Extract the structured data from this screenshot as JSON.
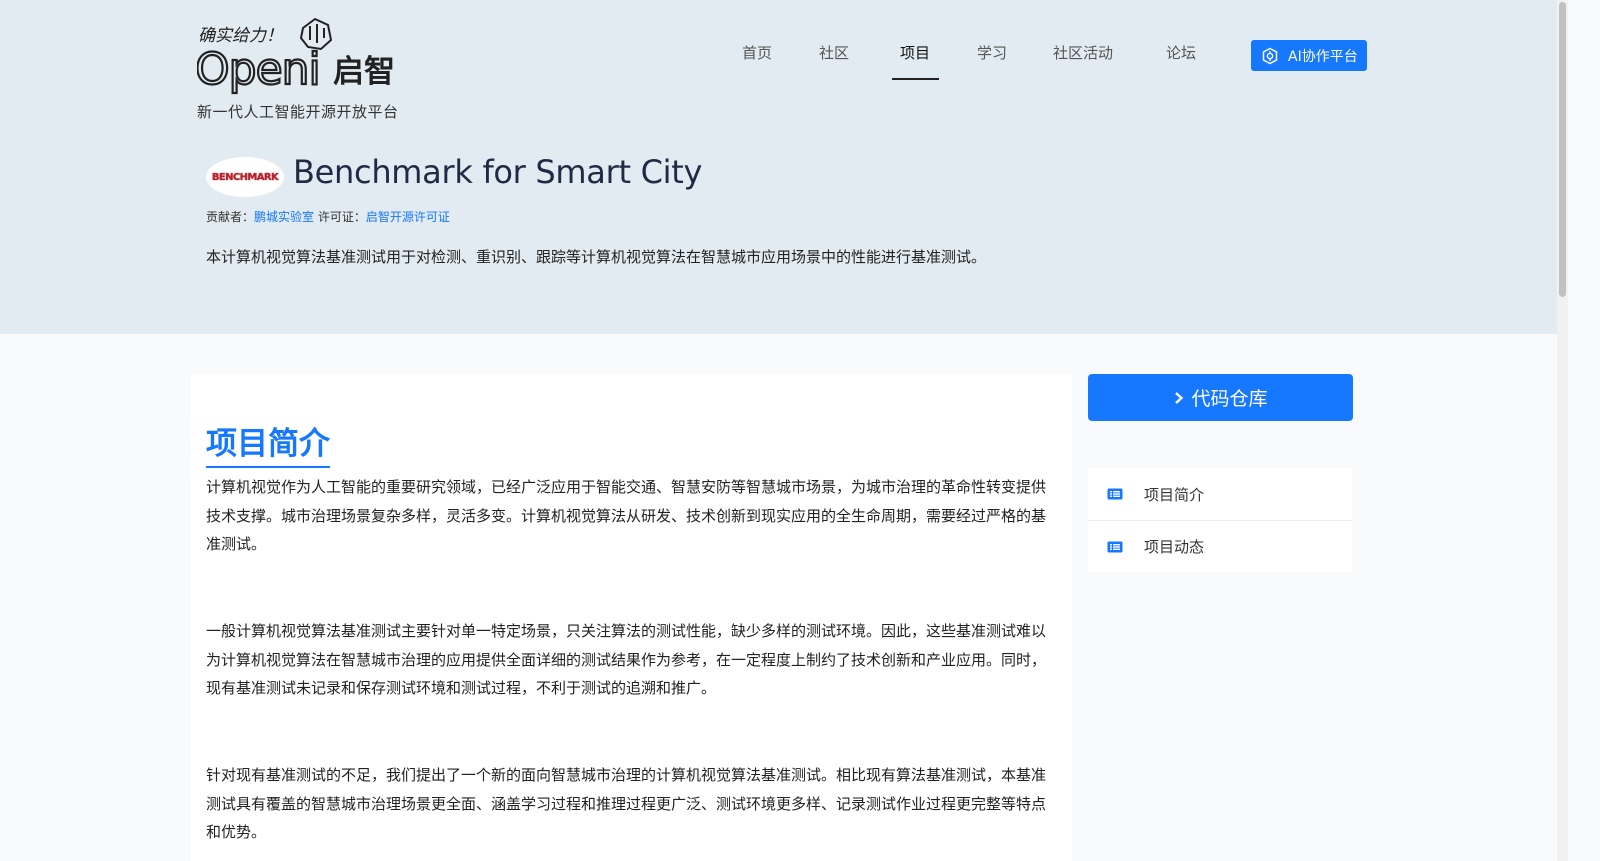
{
  "brand": {
    "handwritten": "确实给力！",
    "wordmark": "Openi",
    "cn_name": "启智",
    "slogan": "新一代人工智能开源开放平台"
  },
  "nav": {
    "items": [
      {
        "label": "首页"
      },
      {
        "label": "社区"
      },
      {
        "label": "项目",
        "active": true
      },
      {
        "label": "学习"
      },
      {
        "label": "社区活动"
      },
      {
        "label": "论坛"
      }
    ],
    "ai_button": {
      "label": "AI协作平台",
      "icon": "ai-brain-icon"
    }
  },
  "project": {
    "logo_text": "BENCHMARK",
    "title": "Benchmark for Smart City",
    "contributor_label": "贡献者：",
    "contributor": "鹏城实验室",
    "license_label": "许可证：",
    "license": "启智开源许可证",
    "summary": "本计算机视觉算法基准测试用于对检测、重识别、跟踪等计算机视觉算法在智慧城市应用场景中的性能进行基准测试。"
  },
  "content": {
    "section_title": "项目简介",
    "paragraphs": [
      "计算机视觉作为人工智能的重要研究领域，已经广泛应用于智能交通、智慧安防等智慧城市场景，为城市治理的革命性转变提供技术支撑。城市治理场景复杂多样，灵活多变。计算机视觉算法从研发、技术创新到现实应用的全生命周期，需要经过严格的基准测试。",
      "一般计算机视觉算法基准测试主要针对单一特定场景，只关注算法的测试性能，缺少多样的测试环境。因此，这些基准测试难以为计算机视觉算法在智慧城市治理的应用提供全面详细的测试结果作为参考，在一定程度上制约了技术创新和产业应用。同时，现有基准测试未记录和保存测试环境和测试过程，不利于测试的追溯和推广。",
      "针对现有基准测试的不足，我们提出了一个新的面向智慧城市治理的计算机视觉算法基准测试。相比现有算法基准测试，本基准测试具有覆盖的智慧城市治理场景更全面、涵盖学习过程和推理过程更广泛、测试环境更多样、记录测试作业过程更完整等特点和优势。"
    ]
  },
  "sidebar": {
    "repo_button": "代码仓库",
    "menu": [
      {
        "label": "项目简介",
        "icon": "list-icon"
      },
      {
        "label": "项目动态",
        "icon": "list-icon"
      }
    ]
  },
  "colors": {
    "accent": "#1677ff",
    "hero_bg": "#e2ebf2",
    "page_bg": "#f9fafb"
  }
}
